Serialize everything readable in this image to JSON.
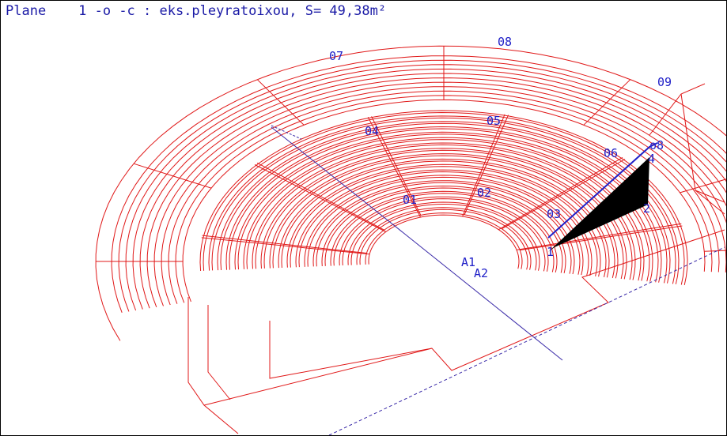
{
  "status": {
    "mode": "Plane",
    "gap": "    ",
    "command": "1 -o -c : eks.pleyratoixou, S= 49,38m²"
  },
  "colors": {
    "background": "#ffffff",
    "wire": "#e01818",
    "label": "#2020c8",
    "axis": "#3a2aa8",
    "fill": "#000000"
  },
  "sector_labels": [
    "01",
    "02",
    "03",
    "04",
    "05",
    "06",
    "07",
    "08",
    "09",
    "o8"
  ],
  "point_labels": [
    "1",
    "2",
    "4",
    "A1",
    "A2"
  ]
}
